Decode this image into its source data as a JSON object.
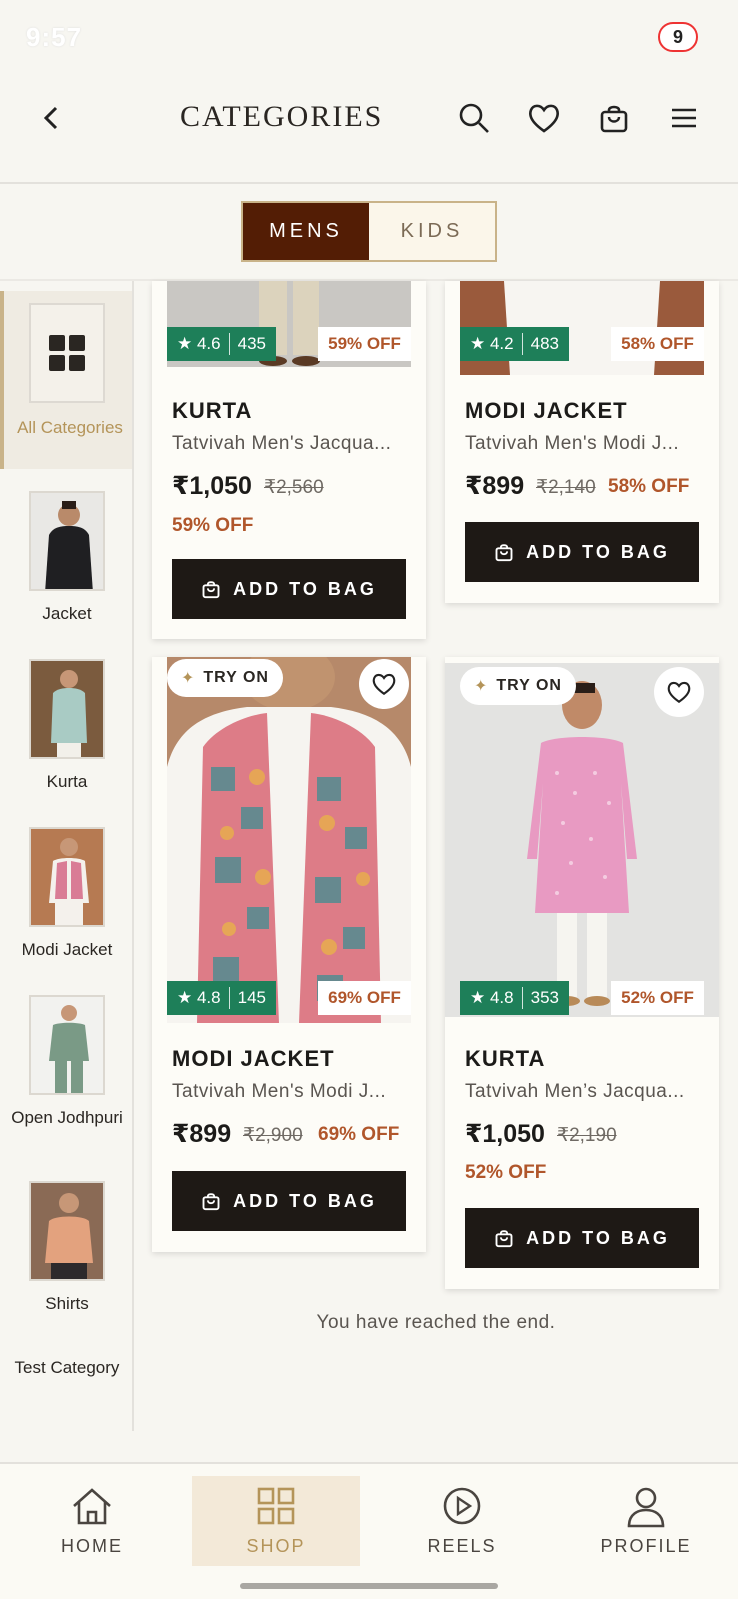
{
  "status_bar": {
    "time": "9:57",
    "battery": "9"
  },
  "header": {
    "title": "CATEGORIES"
  },
  "segment": {
    "mens": "MENS",
    "kids": "KIDS",
    "active": "MENS"
  },
  "sidebar": {
    "all_label": "All Categories",
    "items": [
      {
        "label": "Jacket"
      },
      {
        "label": "Kurta"
      },
      {
        "label": "Modi Jacket"
      },
      {
        "label": "Open Jodhpuri"
      },
      {
        "label": "Shirts"
      },
      {
        "label": "Test Category"
      }
    ]
  },
  "products": [
    {
      "rating": "4.6",
      "reviews": "435",
      "badge": "59% OFF",
      "category": "KURTA",
      "name": "Tatvivah Men's Jacqua...",
      "price": "₹1,050",
      "mrp": "₹2,560",
      "off": "59% OFF",
      "button": "ADD TO BAG"
    },
    {
      "rating": "4.2",
      "reviews": "483",
      "badge": "58% OFF",
      "category": "MODI JACKET",
      "name": "Tatvivah Men's Modi J...",
      "price": "₹899",
      "mrp": "₹2,140",
      "off": "58% OFF",
      "button": "ADD TO BAG"
    },
    {
      "try_on": "TRY ON",
      "rating": "4.8",
      "reviews": "145",
      "badge": "69% OFF",
      "category": "MODI JACKET",
      "name": "Tatvivah Men's Modi J...",
      "price": "₹899",
      "mrp": "₹2,900",
      "off": "69% OFF",
      "button": "ADD TO BAG"
    },
    {
      "try_on": "TRY ON",
      "rating": "4.8",
      "reviews": "353",
      "badge": "52% OFF",
      "category": "KURTA",
      "name": "Tatvivah Men’s Jacqua...",
      "price": "₹1,050",
      "mrp": "₹2,190",
      "off": "52% OFF",
      "button": "ADD TO BAG"
    }
  ],
  "end_message": "You have reached the end.",
  "bottom_nav": [
    {
      "label": "HOME",
      "icon": "home-icon"
    },
    {
      "label": "SHOP",
      "icon": "grid-icon",
      "active": true
    },
    {
      "label": "REELS",
      "icon": "play-icon"
    },
    {
      "label": "PROFILE",
      "icon": "person-icon"
    }
  ],
  "colors": {
    "accent": "#531d05",
    "gold": "#b49459",
    "rating_green": "#1e7f59",
    "discount": "#b0562b",
    "button_dark": "#1e1915"
  }
}
